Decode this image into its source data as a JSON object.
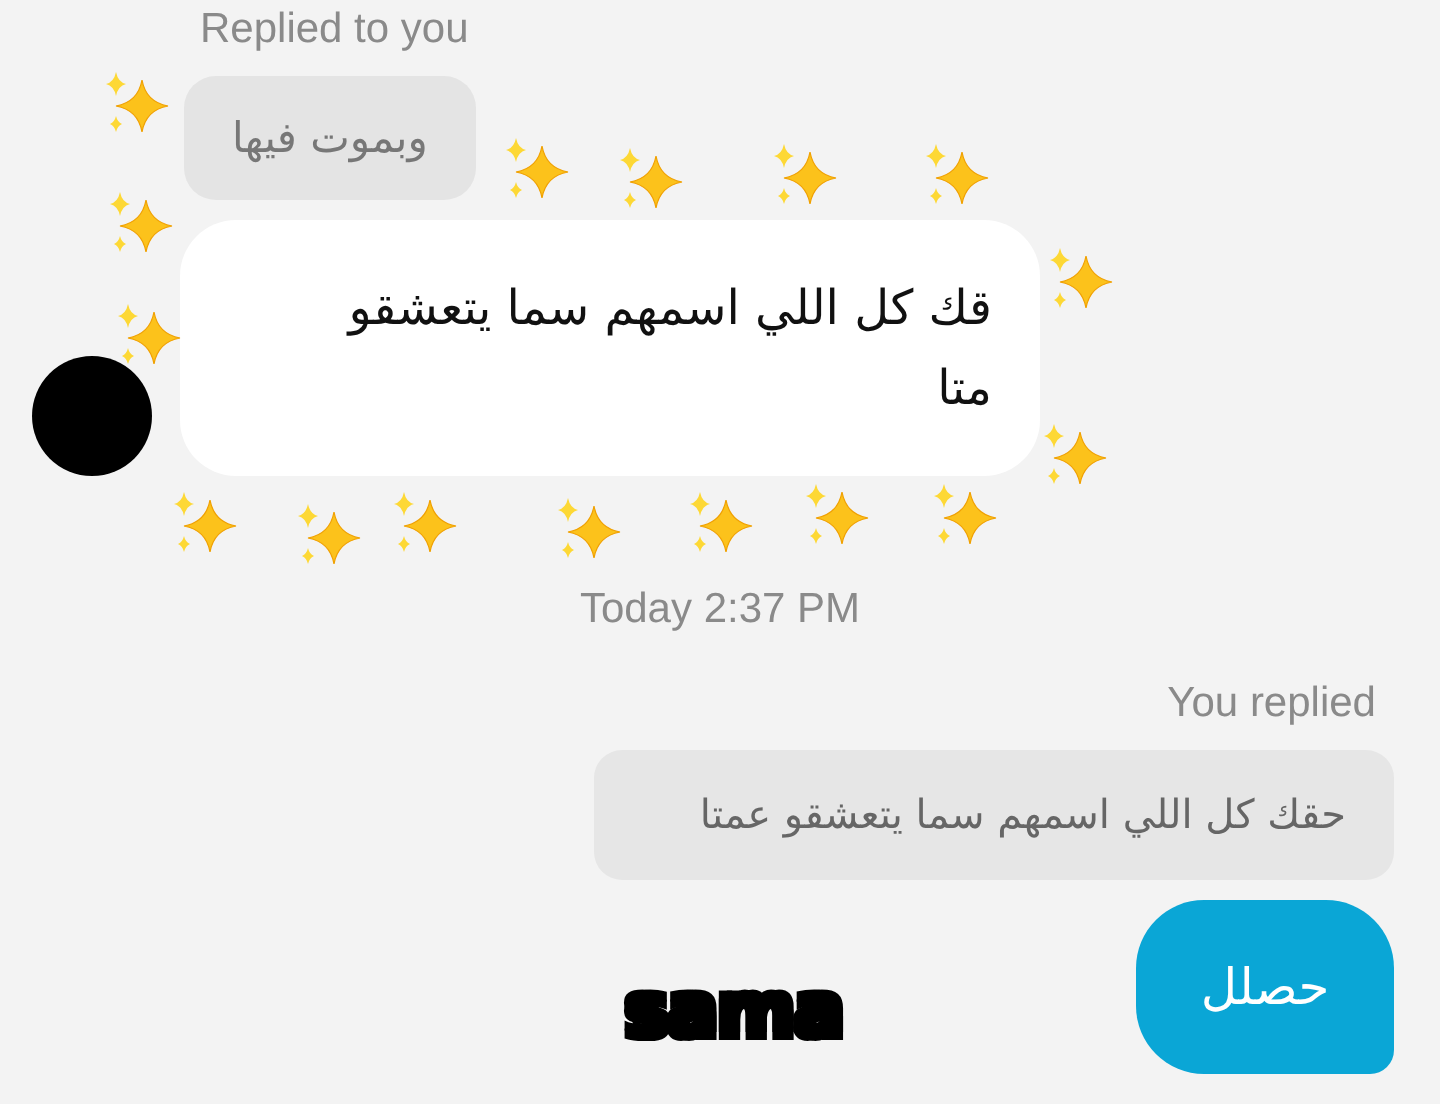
{
  "incoming": {
    "reply_label": "Replied to you",
    "quoted": "وبموت فيها",
    "message": "قك كل اللي اسمهم سما يتعشقو\nمتا"
  },
  "timestamp": "Today 2:37 PM",
  "outgoing": {
    "reply_label": "You replied",
    "quoted": "حقك كل اللي اسمهم سما يتعشقو عمتا",
    "message": "حصلل"
  },
  "caption": "sama"
}
